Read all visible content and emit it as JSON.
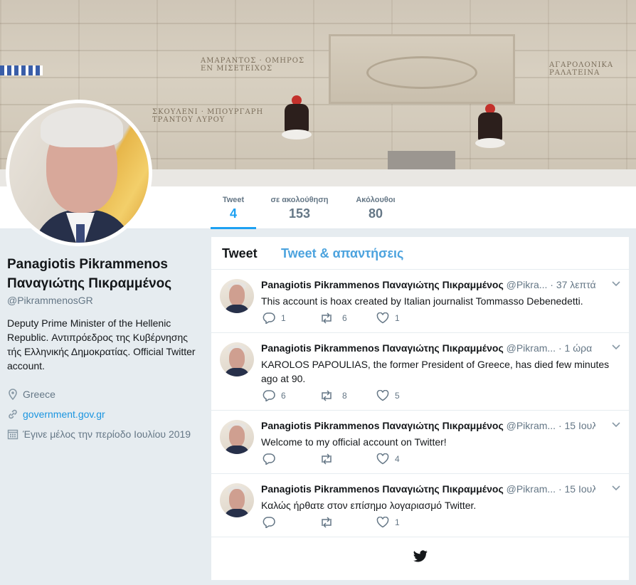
{
  "nav": {
    "stats": [
      {
        "label": "Tweet",
        "value": "4"
      },
      {
        "label": "σε ακολούθηση",
        "value": "153"
      },
      {
        "label": "Ακόλουθοι",
        "value": "80"
      }
    ]
  },
  "profile": {
    "name": "Panagiotis Pikrammenos Παναγιώτης Πικραμμένος",
    "handle": "@PikrammenosGR",
    "bio": "Deputy Prime Minister of the Hellenic Republic. Αντιπρόεδρος της Κυβέρνησης τής Ελληνικής Δημοκρατίας. Official Twitter account.",
    "location": "Greece",
    "website": "government.gov.gr",
    "joined": "Έγινε μέλος την περίοδο Ιουλίου 2019"
  },
  "timeline": {
    "tabs": [
      "Tweet",
      "Tweet & απαντήσεις"
    ],
    "tweets": [
      {
        "name": "Panagiotis Pikrammenos Παναγιώτης Πικραμμένος",
        "handle": "@Pikra...",
        "time": "· 37 λεπτά",
        "text": "This account is hoax created by Italian journalist Tommasso Debenedetti.",
        "replies": "1",
        "retweets": "6",
        "likes": "1"
      },
      {
        "name": "Panagiotis Pikrammenos Παναγιώτης Πικραμμένος",
        "handle": "@Pikram...",
        "time": "· 1 ώρα",
        "text": "KAROLOS PAPOULIAS, the former President of Greece, has died few minutes ago at 90.",
        "replies": "6",
        "retweets": "8",
        "likes": "5"
      },
      {
        "name": "Panagiotis Pikrammenos Παναγιώτης Πικραμμένος",
        "handle": "@Pikram...",
        "time": "· 15 Ιουλ",
        "text": "Welcome to my official account on Twitter!",
        "replies": "",
        "retweets": "",
        "likes": "4"
      },
      {
        "name": "Panagiotis Pikrammenos Παναγιώτης Πικραμμένος",
        "handle": "@Pikram...",
        "time": "· 15 Ιουλ",
        "text": "Καλώς ήρθατε στον επίσημο λογαριασμό Twitter.",
        "replies": "",
        "retweets": "",
        "likes": "1"
      }
    ]
  },
  "colors": {
    "accent": "#1da1f2",
    "link": "#1b95e0",
    "background": "#e6ecf0"
  },
  "icons": [
    "location-icon",
    "link-icon",
    "calendar-icon",
    "reply-icon",
    "retweet-icon",
    "like-icon",
    "caret-down-icon",
    "twitter-bird-icon"
  ]
}
